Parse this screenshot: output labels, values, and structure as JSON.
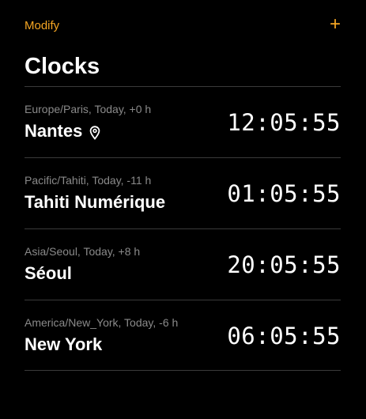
{
  "header": {
    "modify_label": "Modify",
    "add_label": "+",
    "title": "Clocks"
  },
  "colors": {
    "background": "#000000",
    "accent": "#f5a623",
    "text": "#ffffff",
    "muted": "#8a8a8a",
    "divider": "#3a3a3a"
  },
  "clocks": [
    {
      "tz_info": "Europe/Paris, Today, +0 h",
      "city": "Nantes",
      "time": "12:05:55",
      "icon": "location-pin-icon"
    },
    {
      "tz_info": "Pacific/Tahiti, Today, -11 h",
      "city": "Tahiti Numérique",
      "time": "01:05:55"
    },
    {
      "tz_info": "Asia/Seoul, Today, +8 h",
      "city": "Séoul",
      "time": "20:05:55"
    },
    {
      "tz_info": "America/New_York, Today, -6 h",
      "city": "New York",
      "time": "06:05:55"
    }
  ]
}
